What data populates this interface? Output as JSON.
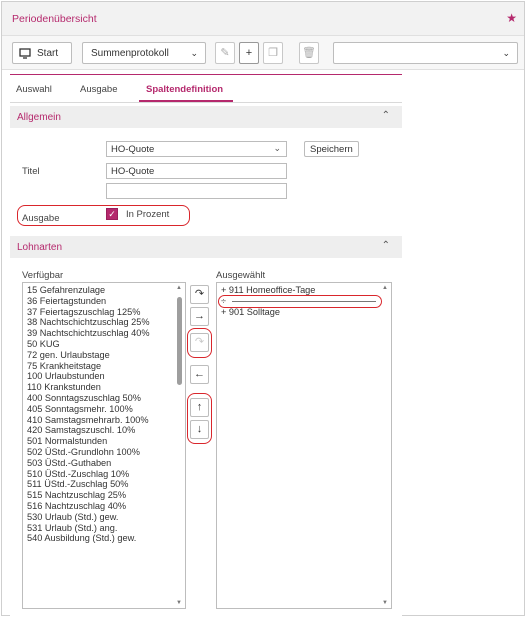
{
  "window": {
    "title": "Periodenübersicht"
  },
  "toolbar": {
    "start_label": "Start",
    "protocol_select": "Summenprotokoll",
    "right_select": ""
  },
  "tabs": [
    {
      "label": "Auswahl"
    },
    {
      "label": "Ausgabe"
    },
    {
      "label": "Spaltendefinition"
    }
  ],
  "allgemein": {
    "header": "Allgemein",
    "dropdown_value": "HO-Quote",
    "save_label": "Speichern",
    "titel_label": "Titel",
    "titel_value": "HO-Quote",
    "extra_value": "",
    "ausgabe_label": "Ausgabe",
    "in_prozent_label": "In Prozent",
    "in_prozent_checked": true
  },
  "lohnarten": {
    "header": "Lohnarten",
    "available_label": "Verfügbar",
    "selected_label": "Ausgewählt",
    "available": [
      "15 Gefahrenzulage",
      "36 Feiertagstunden",
      "37 Feiertagszuschlag 125%",
      "38 Nachtschichtzuschlag 25%",
      "39 Nachtschichtzuschlag 40%",
      "50 KUG",
      "72 gen. Urlaubstage",
      "75 Krankheitstage",
      "100 Urlaubstunden",
      "110 Krankstunden",
      "400 Sonntagszuschlag 50%",
      "405 Sonntagsmehr. 100%",
      "410 Samstagsmehrarb. 100%",
      "420 Samstagszuschl. 10%",
      "501 Normalstunden",
      "502 ÜStd.-Grundlohn 100%",
      "503 ÜStd.-Guthaben",
      "510 ÜStd.-Zuschlag 10%",
      "511 ÜStd.-Zuschlag 50%",
      "515 Nachtzuschlag 25%",
      "516 Nachtzuschlag 40%",
      "530 Urlaub (Std.) gew.",
      "531 Urlaub (Std.) ang.",
      "540 Ausbildung (Std.) gew."
    ],
    "selected_first": "+ 911 Homeoffice-Tage",
    "selected_divider": "÷",
    "selected_last": "+ 901 Solltage"
  },
  "colors": {
    "accent": "#b5296d",
    "highlight": "#d9262c"
  },
  "icons": {
    "favorite": "star-plus-icon",
    "start": "monitor-icon",
    "edit": "pencil-icon",
    "add": "plus-icon",
    "copy": "copy-icon",
    "delete": "trash-icon"
  }
}
